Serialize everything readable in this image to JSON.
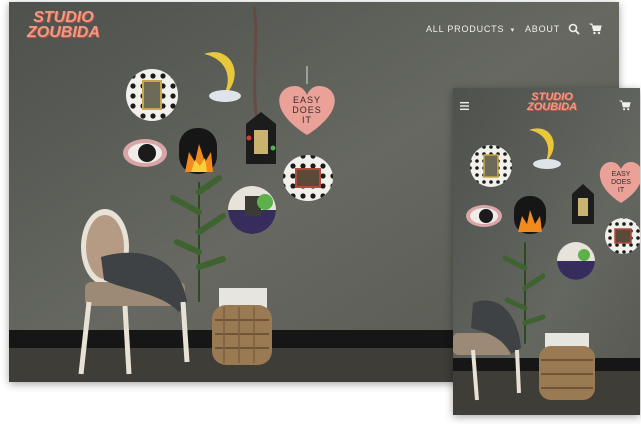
{
  "brand": {
    "logo_line1": "STUDIO",
    "logo_line2": "ZOUBIDA",
    "logo_color": "#f09a84"
  },
  "desktop_nav": {
    "all_products_label": "ALL PRODUCTS",
    "dropdown_icon": "caret-down-icon",
    "about_label": "ABOUT",
    "search_icon": "search-icon",
    "cart_icon": "cart-icon"
  },
  "mobile_nav": {
    "menu_icon": "hamburger-icon",
    "cart_icon": "cart-icon"
  },
  "hero": {
    "heart_sign_line1": "EASY",
    "heart_sign_line2": "DOES",
    "heart_sign_line3": "IT"
  },
  "colors": {
    "wall": "#5b5d57",
    "heart": "#e9a198",
    "moon": "#e9c73b",
    "nav_text": "#f1efe9"
  }
}
